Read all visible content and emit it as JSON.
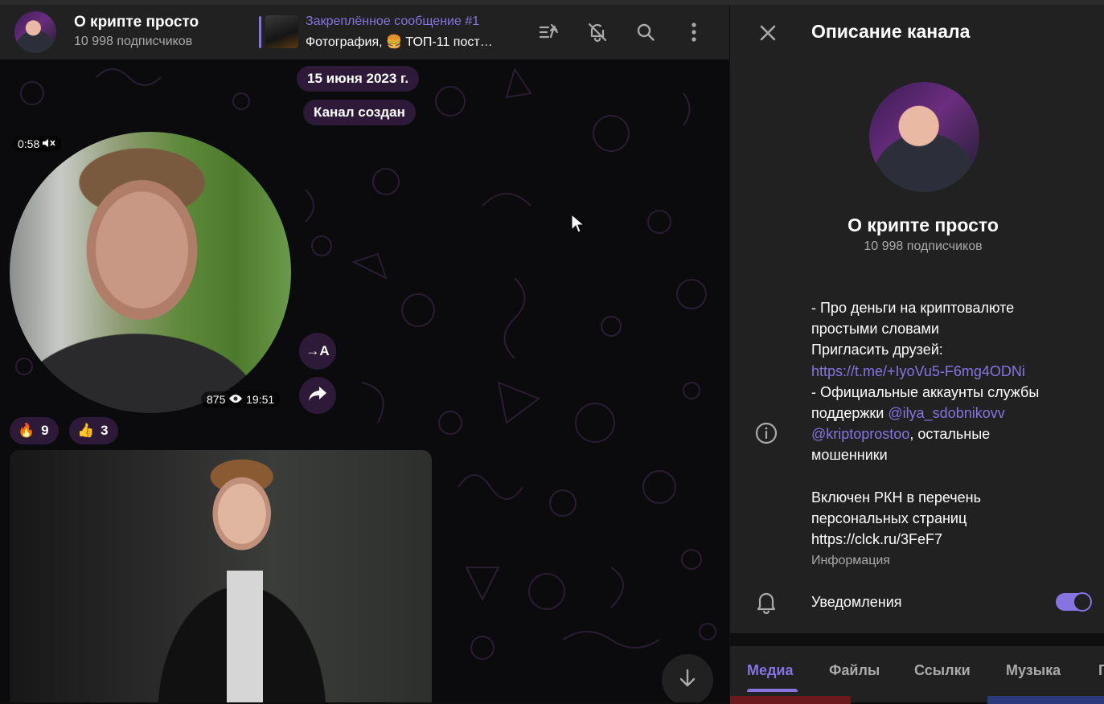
{
  "header": {
    "title": "О крипте просто",
    "subscribers": "10 998 подписчиков",
    "pinned": {
      "title": "Закреплённое сообщение #1",
      "text": "Фотография, 🍔 ТОП-11 пост…"
    }
  },
  "chat": {
    "date_label": "15 июня 2023 г.",
    "service_message": "Канал создан",
    "video_message": {
      "duration": "0:58",
      "views": "875",
      "time": "19:51"
    },
    "translate_label": "→A",
    "reactions": [
      {
        "emoji": "🔥",
        "count": "9"
      },
      {
        "emoji": "👍",
        "count": "3"
      }
    ]
  },
  "panel": {
    "title": "Описание канала",
    "channel_name": "О крипте просто",
    "subscribers": "10 998 подписчиков",
    "description": {
      "line1": "- Про деньги на криптовалюте",
      "line2": "простыми словами",
      "line3": "Пригласить друзей:",
      "invite_link": "https://t.me/+IyoVu5-F6mg4ODNi",
      "line5": "- Официальные аккаунты службы",
      "line6_prefix": "поддержки ",
      "support_handle_1": "@ilya_sdobnikovv",
      "support_handle_2": "@kriptoprostoo",
      "line7_suffix": ", остальные",
      "line8": "мошенники",
      "line9": "Включен РКН в перечень",
      "line10": "персональных страниц",
      "line11": "https://clck.ru/3FeF7"
    },
    "info_caption": "Информация",
    "notifications_label": "Уведомления",
    "notifications_enabled": true,
    "tabs": [
      "Медиа",
      "Файлы",
      "Ссылки",
      "Музыка",
      "Г"
    ],
    "active_tab": "Медиа"
  },
  "colors": {
    "accent": "#8774e1",
    "panel_bg": "#212121",
    "chat_bg": "#0b0b0d",
    "muted_text": "#aaaaaa"
  }
}
